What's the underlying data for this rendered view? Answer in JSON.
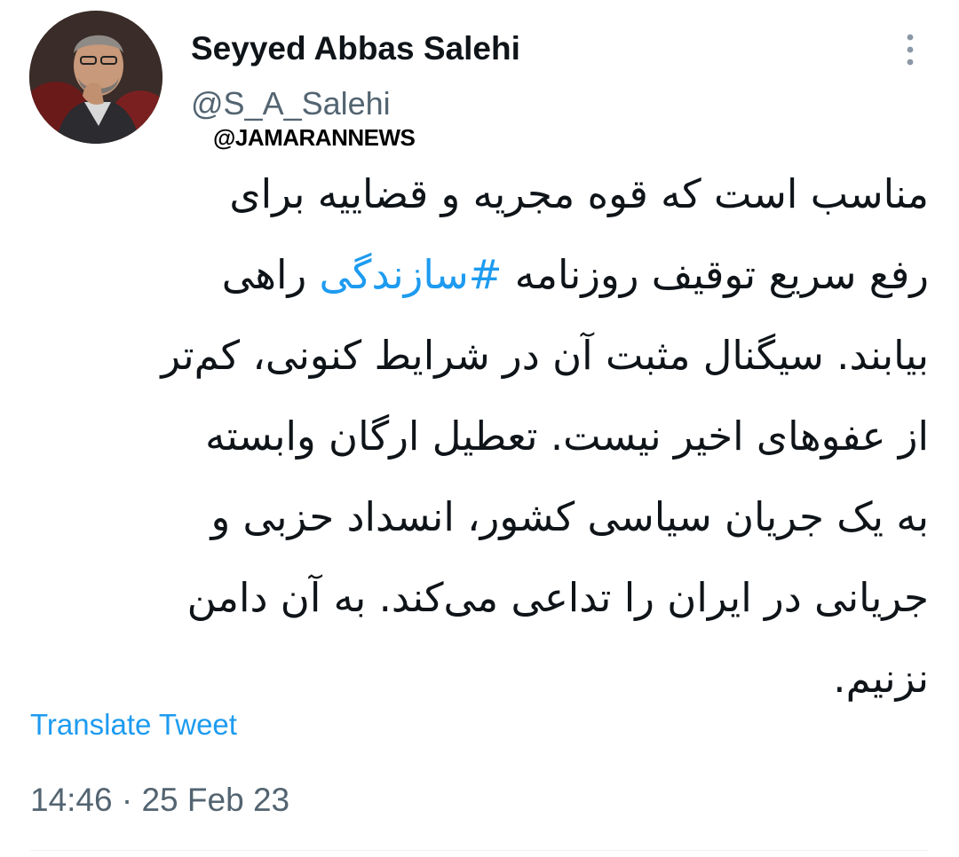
{
  "author": {
    "display_name": "Seyyed Abbas Salehi",
    "handle": "@S_A_Salehi",
    "avatar_icon": "profile-photo"
  },
  "watermark": "@JAMARANNEWS",
  "more_icon": "more-dots-icon",
  "tweet": {
    "lines": [
      {
        "text": "مناسب است که قوه مجریه و قضاییه برای"
      },
      {
        "before": "رفع سریع توقیف روزنامه ",
        "hashtag": "#سازندگی",
        "after": " راهی"
      },
      {
        "text": "بیابند. سیگنال مثبت آن در شرایط کنونی، کم‌تر"
      },
      {
        "text": "از عفوهای اخیر نیست. تعطیل ارگان وابسته"
      },
      {
        "text": "به یک جریان سیاسی کشور، انسداد حزبی و"
      },
      {
        "text": "جریانی در ایران را تداعی می‌کند. به آن دامن"
      },
      {
        "text": "نزنیم."
      }
    ]
  },
  "translate_label": "Translate Tweet",
  "timestamp": "14:46 · 25 Feb 23",
  "colors": {
    "link": "#1d9bf0",
    "secondary_text": "#536471",
    "primary_text": "#0f1419"
  }
}
